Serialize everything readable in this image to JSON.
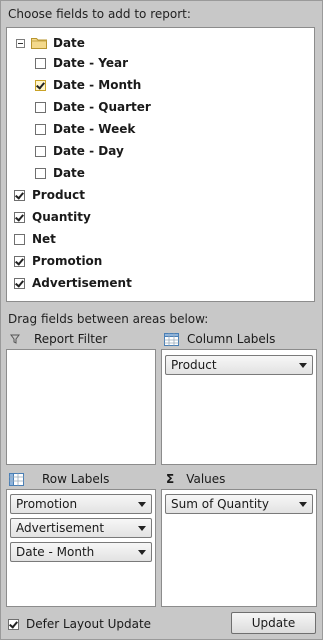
{
  "field_list_heading": "Choose fields to add to report:",
  "fields": {
    "date_group": {
      "label": "Date",
      "expanded": true
    },
    "date_children": [
      {
        "label": "Date - Year",
        "checked": false
      },
      {
        "label": "Date - Month",
        "checked": true
      },
      {
        "label": "Date - Quarter",
        "checked": false
      },
      {
        "label": "Date - Week",
        "checked": false
      },
      {
        "label": "Date - Day",
        "checked": false
      },
      {
        "label": "Date",
        "checked": false
      }
    ],
    "top_level": [
      {
        "label": "Product",
        "checked": true
      },
      {
        "label": "Quantity",
        "checked": true
      },
      {
        "label": "Net",
        "checked": false
      },
      {
        "label": "Promotion",
        "checked": true
      },
      {
        "label": "Advertisement",
        "checked": true
      }
    ]
  },
  "areas_heading": "Drag fields between areas below:",
  "areas": {
    "report_filter": {
      "label": "Report Filter",
      "icon": "filter-icon",
      "items": []
    },
    "column_labels": {
      "label": "Column Labels",
      "icon": "column-grid-icon",
      "items": [
        "Product"
      ]
    },
    "row_labels": {
      "label": "Row Labels",
      "icon": "row-grid-icon",
      "items": [
        "Promotion",
        "Advertisement",
        "Date - Month"
      ]
    },
    "values": {
      "label": "Values",
      "icon": "sigma-icon",
      "items": [
        "Sum of Quantity"
      ]
    }
  },
  "footer": {
    "defer_label": "Defer Layout Update",
    "defer_checked": true,
    "update_label": "Update"
  },
  "colors": {
    "background": "#c8c8c8",
    "panel": "#ffffff",
    "highlight_checkbox": "#fff6cc"
  }
}
